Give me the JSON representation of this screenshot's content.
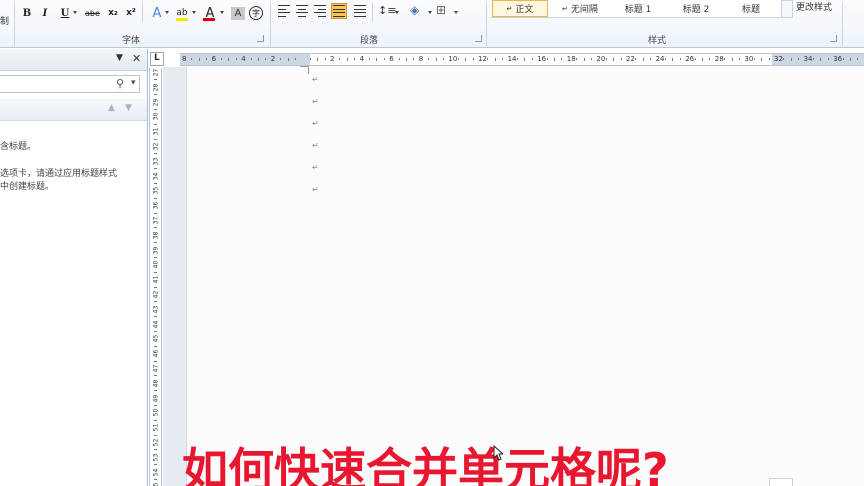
{
  "ribbon": {
    "clipboard_partial": "制",
    "font_group_label": "字体",
    "paragraph_group_label": "段落",
    "styles_group_label": "样式",
    "font_buttons": {
      "bold": "B",
      "italic": "I",
      "underline": "U",
      "strike": "abe",
      "subscript": "x₂",
      "superscript": "x²",
      "text_effect": "A",
      "highlight": "ab",
      "font_color": "A",
      "char_shading": "A",
      "enclose": "字"
    },
    "styles": [
      {
        "label": "正文",
        "prefix": "↵",
        "selected": true
      },
      {
        "label": "无间隔",
        "prefix": "↵",
        "selected": false
      },
      {
        "label": "标题 1",
        "prefix": "",
        "selected": false
      },
      {
        "label": "标题 2",
        "prefix": "",
        "selected": false
      },
      {
        "label": "标题",
        "prefix": "",
        "selected": false
      }
    ],
    "change_styles": "更改样式",
    "colors": {
      "highlight": "#f6e600",
      "font_color": "#d40000",
      "active_align": "#f7c35a"
    }
  },
  "nav_pane": {
    "close": "✕",
    "dropdown": "▼",
    "search_icon": "search-icon",
    "search_dropdown": "▾",
    "up": "▲",
    "down": "▼",
    "line1": "含标题。",
    "line2": "选项卡，请通过应用标题样式",
    "line3": "中创建标题。"
  },
  "ruler_corner": "L",
  "document": {
    "paragraph_marks": [
      "↵",
      "↵",
      "↵",
      "↵",
      "↵",
      "↵"
    ],
    "overlay_text": "如何快速合并单元格呢?"
  }
}
